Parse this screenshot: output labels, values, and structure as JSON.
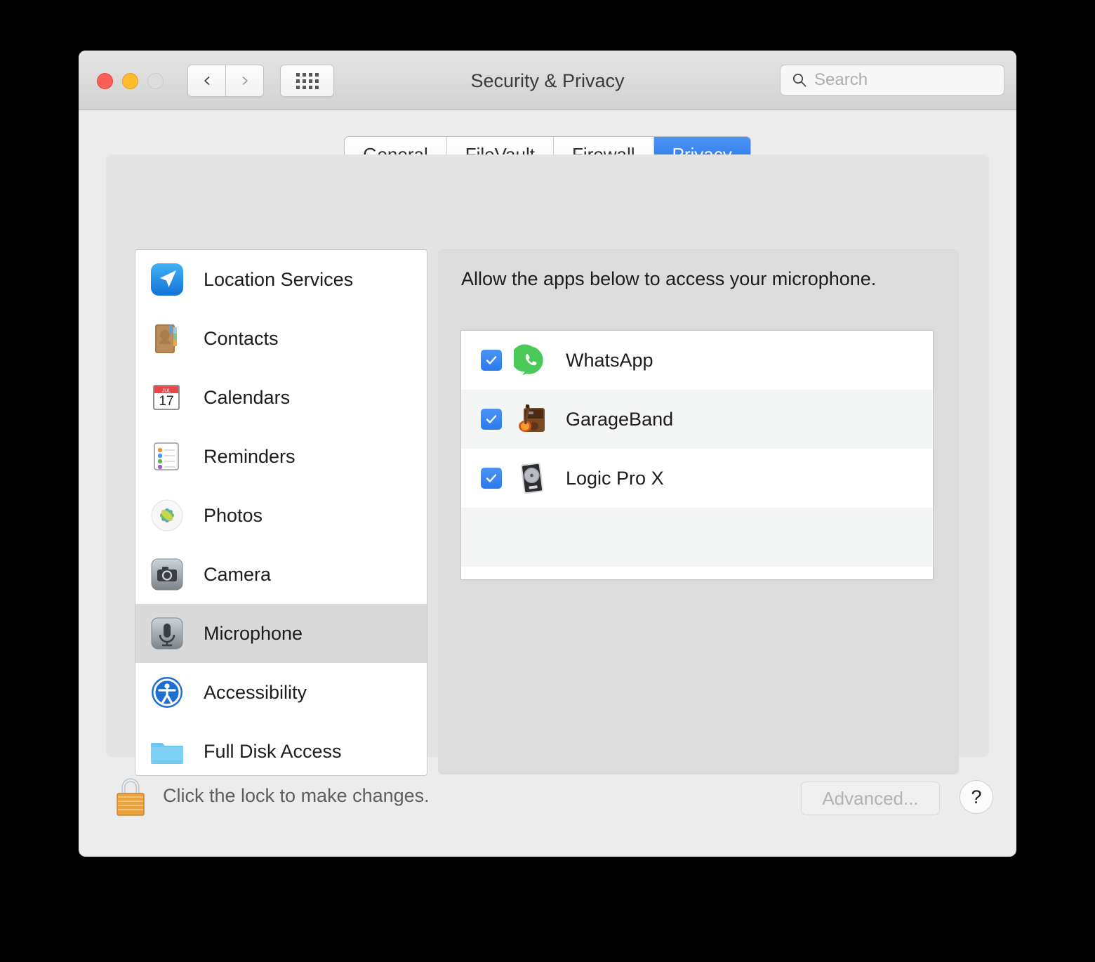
{
  "window": {
    "title": "Security & Privacy",
    "traffic_lights": [
      "close",
      "minimize",
      "zoom"
    ],
    "nav": {
      "back_icon": "chevron-left-icon",
      "forward_icon": "chevron-right-icon",
      "showall_icon": "grid-icon"
    }
  },
  "search": {
    "placeholder": "Search",
    "icon": "search-icon"
  },
  "tabs": [
    {
      "label": "General",
      "selected": false
    },
    {
      "label": "FileVault",
      "selected": false
    },
    {
      "label": "Firewall",
      "selected": false
    },
    {
      "label": "Privacy",
      "selected": true
    }
  ],
  "sidebar": {
    "items": [
      {
        "label": "Location Services",
        "icon": "location-services-icon",
        "selected": false
      },
      {
        "label": "Contacts",
        "icon": "contacts-icon",
        "selected": false
      },
      {
        "label": "Calendars",
        "icon": "calendars-icon",
        "selected": false
      },
      {
        "label": "Reminders",
        "icon": "reminders-icon",
        "selected": false
      },
      {
        "label": "Photos",
        "icon": "photos-icon",
        "selected": false
      },
      {
        "label": "Camera",
        "icon": "camera-icon",
        "selected": false
      },
      {
        "label": "Microphone",
        "icon": "microphone-icon",
        "selected": true
      },
      {
        "label": "Accessibility",
        "icon": "accessibility-icon",
        "selected": false
      },
      {
        "label": "Full Disk Access",
        "icon": "folder-icon",
        "selected": false
      }
    ]
  },
  "right_pane": {
    "description": "Allow the apps below to access your microphone.",
    "apps": [
      {
        "name": "WhatsApp",
        "icon": "whatsapp-icon",
        "checked": true
      },
      {
        "name": "GarageBand",
        "icon": "garageband-icon",
        "checked": true
      },
      {
        "name": "Logic Pro X",
        "icon": "logic-pro-x-icon",
        "checked": true
      }
    ]
  },
  "bottom_bar": {
    "lock_icon": "padlock-icon",
    "lock_text": "Click the lock to make changes.",
    "advanced_label": "Advanced...",
    "help_label": "?"
  },
  "colors": {
    "accent_blue": "#2a7bef",
    "tab_active_blue": "#1c72e8",
    "window_bg": "#ececec",
    "panel_bg": "#e4e4e4",
    "pane_bg": "#dcdcdc",
    "selection_gray": "#d9d9d9"
  },
  "calendar_icon_text": {
    "month": "JUL",
    "day": "17"
  }
}
